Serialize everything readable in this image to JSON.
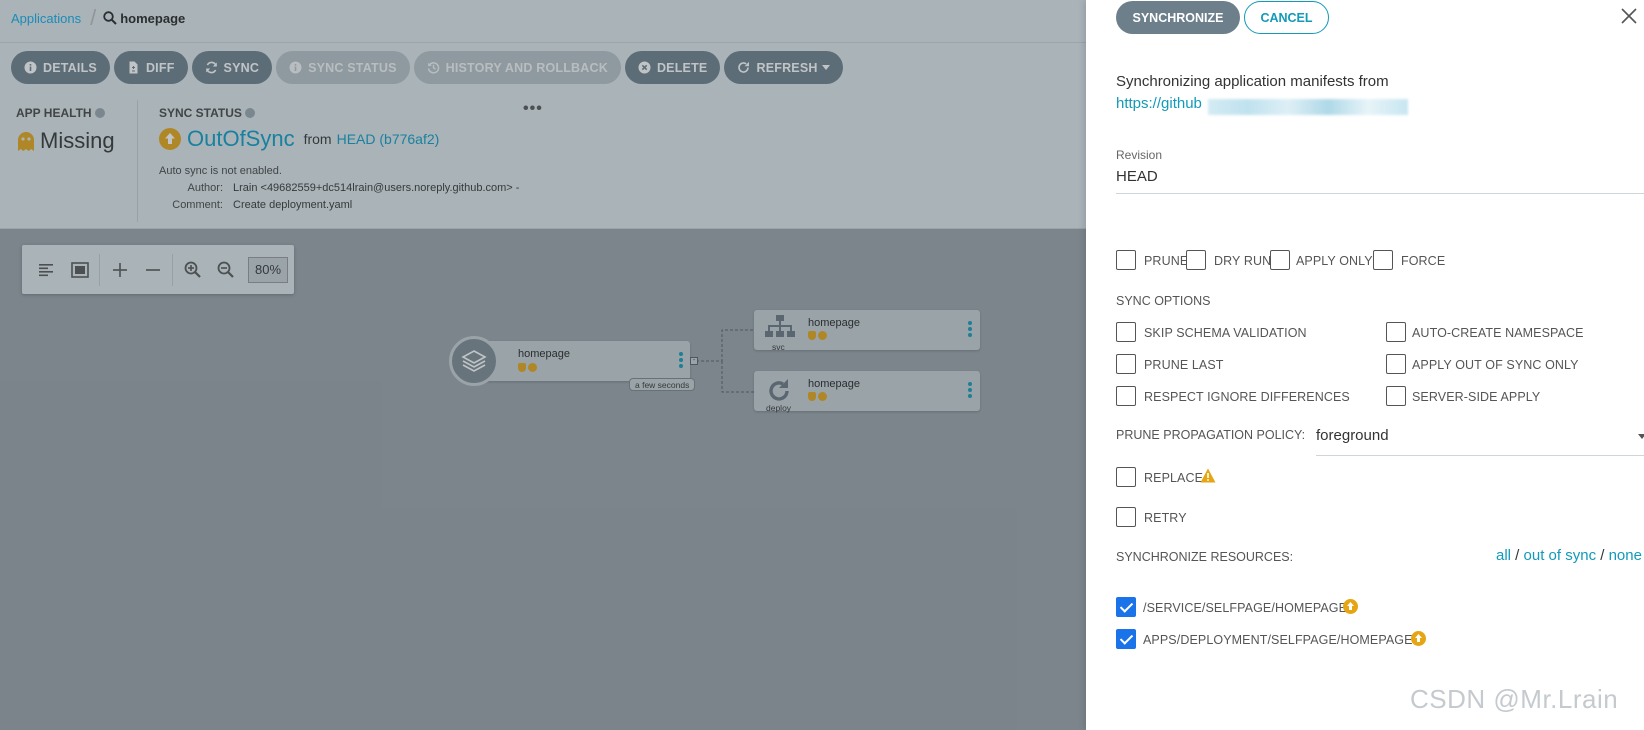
{
  "breadcrumb": {
    "root": "Applications",
    "current": "homepage"
  },
  "toolbar": {
    "details": "DETAILS",
    "diff": "DIFF",
    "sync": "SYNC",
    "sync_status": "SYNC STATUS",
    "history": "HISTORY AND ROLLBACK",
    "delete": "DELETE",
    "refresh": "REFRESH"
  },
  "status": {
    "health_label": "APP HEALTH",
    "health_value": "Missing",
    "sync_label": "SYNC STATUS",
    "sync_value": "OutOfSync",
    "from": "from",
    "revision": "HEAD (b776af2)",
    "autosync": "Auto sync is not enabled.",
    "author_key": "Author:",
    "author_value": "Lrain <49682559+dc514lrain@users.noreply.github.com> -",
    "comment_key": "Comment:",
    "comment_value": "Create deployment.yaml",
    "more": "•••"
  },
  "graph": {
    "zoom": "80%",
    "app_node": {
      "name": "homepage",
      "age": "a few seconds"
    },
    "svc_node": {
      "name": "homepage",
      "kind": "svc"
    },
    "deploy_node": {
      "name": "homepage",
      "kind": "deploy"
    }
  },
  "panel": {
    "synchronize": "SYNCHRONIZE",
    "cancel": "CANCEL",
    "intro": "Synchronizing application manifests from",
    "repo_link": "https://github",
    "revision_label": "Revision",
    "revision_value": "HEAD",
    "opts": {
      "prune": "PRUNE",
      "dry_run": "DRY RUN",
      "apply_only": "APPLY ONLY",
      "force": "FORCE"
    },
    "sync_options_label": "SYNC OPTIONS",
    "sync_options": {
      "skip_schema": "SKIP SCHEMA VALIDATION",
      "auto_ns": "AUTO-CREATE NAMESPACE",
      "prune_last": "PRUNE LAST",
      "apply_oos": "APPLY OUT OF SYNC ONLY",
      "respect_ignore": "RESPECT IGNORE DIFFERENCES",
      "server_side": "SERVER-SIDE APPLY"
    },
    "prune_policy_label": "PRUNE PROPAGATION POLICY:",
    "prune_policy_value": "foreground",
    "replace": "REPLACE",
    "retry": "RETRY",
    "resources_label": "SYNCHRONIZE RESOURCES:",
    "res_all": "all",
    "res_sep1": " / ",
    "res_oos": "out of sync",
    "res_sep2": " / ",
    "res_none": "none",
    "resources": [
      {
        "path": "/SERVICE/SELFPAGE/HOMEPAGE",
        "checked": true
      },
      {
        "path": "APPS/DEPLOYMENT/SELFPAGE/HOMEPAGE",
        "checked": true
      }
    ]
  },
  "watermark": "CSDN @Mr.Lrain",
  "colors": {
    "accent": "#129ab8",
    "button": "#6d7f8b",
    "warning": "#e6a614",
    "checkbox": "#1a73e8"
  }
}
